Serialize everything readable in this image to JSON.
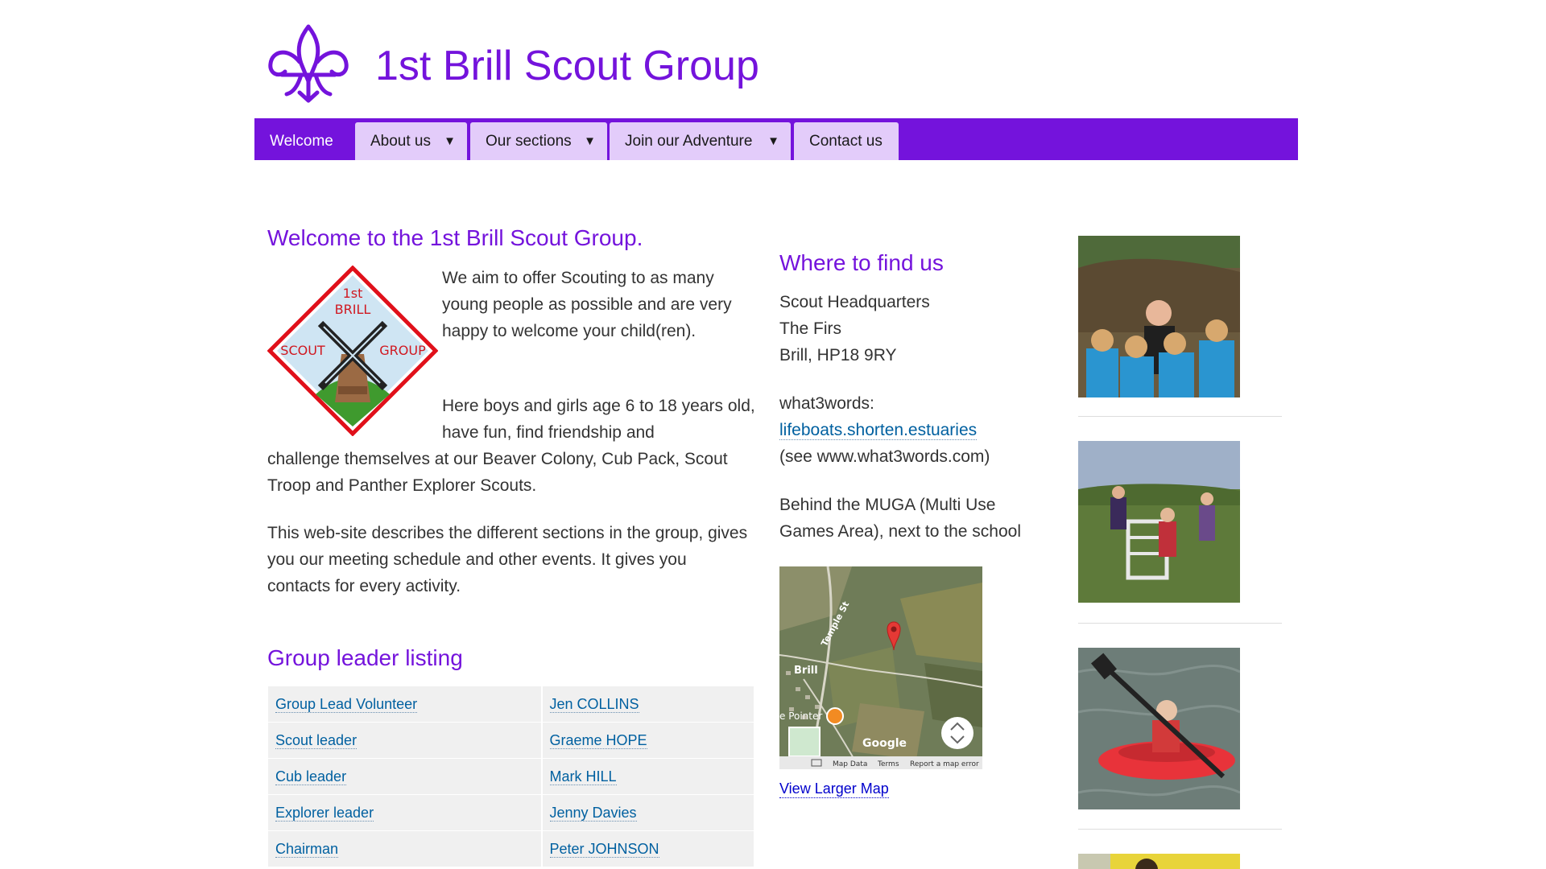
{
  "site": {
    "title": "1st Brill Scout Group"
  },
  "nav": {
    "items": [
      {
        "label": "Welcome",
        "has_dropdown": false,
        "active": true
      },
      {
        "label": "About us",
        "has_dropdown": true,
        "active": false
      },
      {
        "label": "Our sections",
        "has_dropdown": true,
        "active": false
      },
      {
        "label": "Join our Adventure",
        "has_dropdown": true,
        "active": false
      },
      {
        "label": "Contact us",
        "has_dropdown": false,
        "active": false
      }
    ],
    "caret": "▼"
  },
  "welcome": {
    "title": "Welcome to the 1st Brill Scout Group.",
    "badge_text": [
      "1st",
      "BRILL",
      "SCOUT",
      "GROUP"
    ],
    "para1": "We aim to offer Scouting to as many young people as possible and are very happy to welcome your child(ren).",
    "para2_a": "Here boys and girls age 6 to 18 years old, have fun, find friendship and",
    "para2_b": "challenge themselves at our Beaver Colony, Cub Pack, Scout Troop and Panther Explorer Scouts.",
    "para3": "This web-site describes the different sections in the group, gives you our meeting schedule and other events.  It gives you contacts for every activity."
  },
  "leaders": {
    "title": "Group leader listing",
    "rows": [
      {
        "role": "Group Lead Volunteer",
        "name": "Jen COLLINS"
      },
      {
        "role": "Scout leader",
        "name": "Graeme HOPE"
      },
      {
        "role": "Cub leader",
        "name": "Mark HILL"
      },
      {
        "role": "Explorer leader",
        "name": "Jenny Davies"
      },
      {
        "role": "Chairman",
        "name": "Peter JOHNSON"
      }
    ]
  },
  "location": {
    "title": "Where to find us",
    "address": [
      "Scout Headquarters",
      "The Firs",
      "Brill, HP18 9RY"
    ],
    "w3w_label": "what3words:",
    "w3w_link": "lifeboats.shorten.estuaries",
    "w3w_note": "(see www.what3words.com)",
    "behind": "Behind the MUGA (Multi Use Games Area), next to the school",
    "map": {
      "labels": {
        "street": "Temple St",
        "town": "Brill",
        "poi": "e Pointer",
        "brand": "Google"
      },
      "footer": [
        "Map Data",
        "Terms",
        "Report a map error"
      ]
    },
    "map_link": "View Larger Map"
  },
  "colors": {
    "brand_purple": "#7413dc",
    "nav_tab": "#e3ccfa",
    "link": "#0060a0"
  }
}
